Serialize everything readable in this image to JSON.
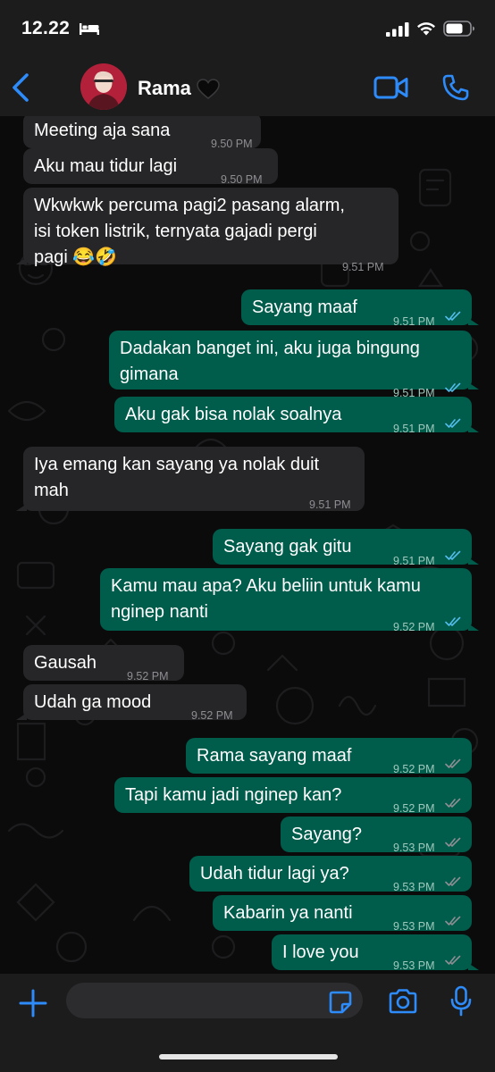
{
  "status_bar": {
    "time": "12.22",
    "icons": [
      "bed-icon",
      "signal-icon",
      "wifi-icon",
      "battery-icon"
    ]
  },
  "header": {
    "contact_name": "Rama",
    "name_emoji": "heart-icon",
    "icons": [
      "back-icon",
      "video-call-icon",
      "voice-call-icon"
    ]
  },
  "colors": {
    "accent": "#2e8bfa",
    "incoming_bubble": "#262628",
    "outgoing_bubble": "#005c4b",
    "read_ticks": "#53bdeb",
    "delivered_ticks": "#8e8e93"
  },
  "messages": [
    {
      "dir": "in",
      "text": "Meeting aja sana",
      "time": "9.50 PM"
    },
    {
      "dir": "in",
      "text": "Aku mau tidur lagi",
      "time": "9.50 PM"
    },
    {
      "dir": "in",
      "text": "Wkwkwk percuma pagi2 pasang alarm,\nisi token listrik, ternyata gajadi pergi\npagi 😂🤣",
      "time": "9.51 PM"
    },
    {
      "dir": "out",
      "text": "Sayang maaf",
      "time": "9.51 PM",
      "status": "read"
    },
    {
      "dir": "out",
      "text": "Dadakan banget ini, aku juga bingung\ngimana",
      "time": "9.51 PM",
      "status": "read"
    },
    {
      "dir": "out",
      "text": "Aku gak bisa nolak soalnya",
      "time": "9.51 PM",
      "status": "read"
    },
    {
      "dir": "in",
      "text": "Iya emang kan sayang ya nolak duit\nmah",
      "time": "9.51 PM"
    },
    {
      "dir": "out",
      "text": "Sayang gak gitu",
      "time": "9.51 PM",
      "status": "read"
    },
    {
      "dir": "out",
      "text": "Kamu mau apa? Aku beliin untuk kamu\nnginep nanti",
      "time": "9.52 PM",
      "status": "read"
    },
    {
      "dir": "in",
      "text": "Gausah",
      "time": "9.52 PM"
    },
    {
      "dir": "in",
      "text": "Udah ga mood",
      "time": "9.52 PM"
    },
    {
      "dir": "out",
      "text": "Rama sayang maaf",
      "time": "9.52 PM",
      "status": "delivered"
    },
    {
      "dir": "out",
      "text": "Tapi kamu jadi nginep kan?",
      "time": "9.52 PM",
      "status": "delivered"
    },
    {
      "dir": "out",
      "text": "Sayang?",
      "time": "9.53 PM",
      "status": "delivered"
    },
    {
      "dir": "out",
      "text": "Udah tidur lagi ya?",
      "time": "9.53 PM",
      "status": "delivered"
    },
    {
      "dir": "out",
      "text": "Kabarin ya nanti",
      "time": "9.53 PM",
      "status": "delivered"
    },
    {
      "dir": "out",
      "text": "I love you",
      "time": "9.53 PM",
      "status": "delivered"
    }
  ],
  "input_bar": {
    "placeholder": "",
    "icons": [
      "plus-icon",
      "sticker-icon",
      "camera-icon",
      "microphone-icon"
    ]
  }
}
